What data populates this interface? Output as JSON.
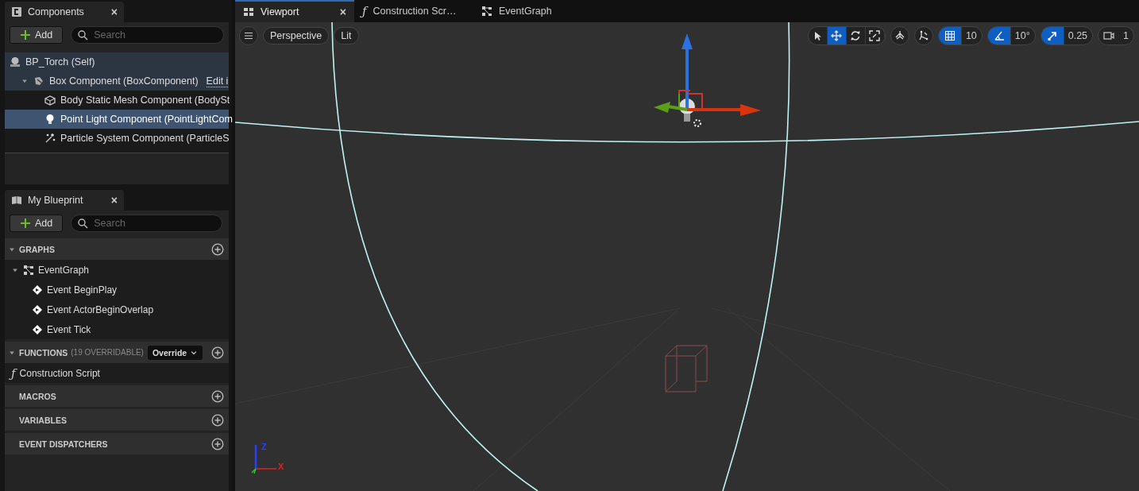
{
  "components_panel": {
    "tab": {
      "title": "Components",
      "close": "×"
    },
    "add_button": "Add",
    "search": {
      "placeholder": "Search"
    },
    "tree": [
      {
        "label": "BP_Torch (Self)",
        "kind": "actor",
        "selected": false,
        "highlighted": true,
        "children": [
          {
            "label": "Box Component (BoxComponent)",
            "kind": "box",
            "selected": false,
            "highlighted": true,
            "expanded": true,
            "link": "Edit i",
            "children": [
              {
                "label": "Body Static Mesh Component (BodySt",
                "kind": "mesh",
                "selected": false,
                "highlighted": false
              },
              {
                "label": "Point Light Component (PointLightCom",
                "kind": "light",
                "selected": true,
                "highlighted": false
              },
              {
                "label": "Particle System Component (ParticleS",
                "kind": "particles",
                "selected": false,
                "highlighted": false
              }
            ]
          }
        ]
      }
    ]
  },
  "blueprint_panel": {
    "tab": {
      "title": "My Blueprint",
      "close": "×"
    },
    "add_button": "Add",
    "search": {
      "placeholder": "Search"
    },
    "sections": [
      {
        "title": "GRAPHS",
        "items": [
          {
            "label": "EventGraph",
            "kind": "graph",
            "expanded": true,
            "children": [
              {
                "label": "Event BeginPlay",
                "kind": "event"
              },
              {
                "label": "Event ActorBeginOverlap",
                "kind": "event"
              },
              {
                "label": "Event Tick",
                "kind": "event"
              }
            ]
          }
        ]
      },
      {
        "title": "FUNCTIONS",
        "note": "(19 OVERRIDABLE)",
        "dropdown": "Override",
        "items": [
          {
            "label": "Construction Script",
            "kind": "function",
            "glyph": "ƒ"
          }
        ]
      },
      {
        "title": "MACROS"
      },
      {
        "title": "VARIABLES"
      },
      {
        "title": "EVENT DISPATCHERS"
      }
    ]
  },
  "editor_tabs": [
    {
      "title": "Viewport",
      "kind": "viewport",
      "selected": true,
      "close": "×"
    },
    {
      "title": "Construction Scr…",
      "kind": "function",
      "glyph": "ƒ",
      "selected": false
    },
    {
      "title": "EventGraph",
      "kind": "graph",
      "selected": false
    }
  ],
  "viewport": {
    "view_mode": "Perspective",
    "lighting": "Lit",
    "transform_tools": [
      {
        "kind": "select",
        "selected": false
      },
      {
        "kind": "translate",
        "selected": true
      },
      {
        "kind": "rotate",
        "selected": false
      },
      {
        "kind": "scale",
        "selected": false
      }
    ],
    "extra_tools": [
      {
        "kind": "surface"
      },
      {
        "kind": "world"
      }
    ],
    "snaps": [
      {
        "kind": "grid",
        "on": true,
        "value": "10"
      },
      {
        "kind": "angle",
        "on": true,
        "value": "10°"
      },
      {
        "kind": "scale",
        "on": true,
        "value": "0.25"
      }
    ],
    "camera_speed": "1",
    "axis_labels": {
      "z": "Z",
      "x": "X"
    }
  }
}
